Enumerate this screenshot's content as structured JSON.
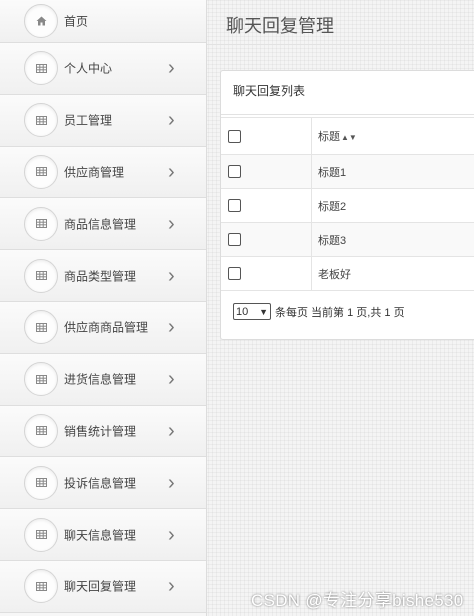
{
  "sidebar": {
    "items": [
      {
        "label": "首页",
        "icon": "home-icon",
        "has_chevron": false
      },
      {
        "label": "个人中心",
        "icon": "list-icon",
        "has_chevron": true
      },
      {
        "label": "员工管理",
        "icon": "list-icon",
        "has_chevron": true
      },
      {
        "label": "供应商管理",
        "icon": "list-icon",
        "has_chevron": true
      },
      {
        "label": "商品信息管理",
        "icon": "list-icon",
        "has_chevron": true
      },
      {
        "label": "商品类型管理",
        "icon": "list-icon",
        "has_chevron": true
      },
      {
        "label": "供应商商品管理",
        "icon": "list-icon",
        "has_chevron": true
      },
      {
        "label": "进货信息管理",
        "icon": "list-icon",
        "has_chevron": true
      },
      {
        "label": "销售统计管理",
        "icon": "list-icon",
        "has_chevron": true
      },
      {
        "label": "投诉信息管理",
        "icon": "list-icon",
        "has_chevron": true
      },
      {
        "label": "聊天信息管理",
        "icon": "list-icon",
        "has_chevron": true
      },
      {
        "label": "聊天回复管理",
        "icon": "list-icon",
        "has_chevron": true
      }
    ]
  },
  "main": {
    "page_title": "聊天回复管理",
    "panel_title": "聊天回复列表",
    "table": {
      "header": "标题",
      "sort_icon": "sort-icon",
      "rows": [
        "标题1",
        "标题2",
        "标题3",
        "老板好"
      ]
    },
    "pager": {
      "page_size": "10",
      "text": "条每页 当前第 1 页,共 1 页"
    }
  },
  "watermark": "CSDN @专注分享bishe530"
}
